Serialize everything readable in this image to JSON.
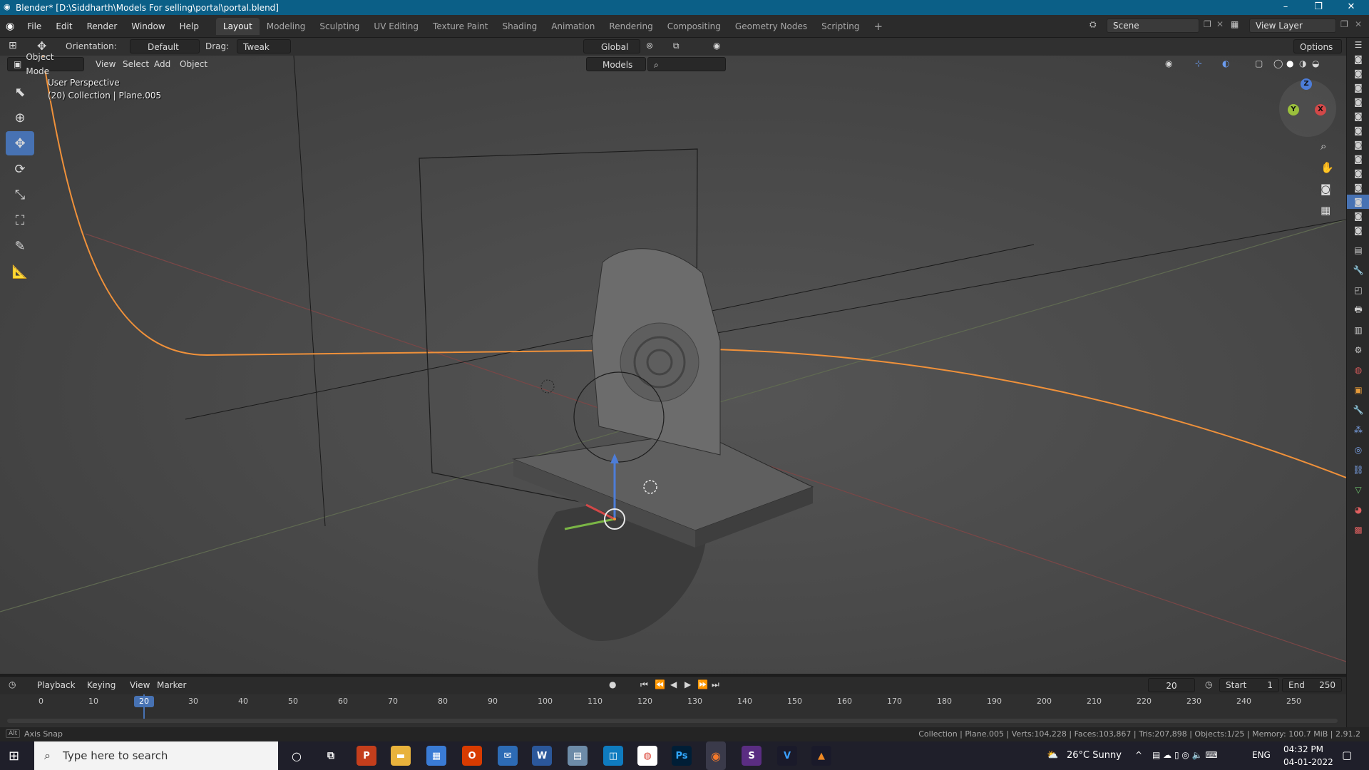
{
  "window": {
    "title": "Blender* [D:\\Siddharth\\Models For selling\\portal\\portal.blend]",
    "minimize": "–",
    "maximize": "❐",
    "close": "✕"
  },
  "menu": {
    "items": [
      "File",
      "Edit",
      "Render",
      "Window",
      "Help"
    ]
  },
  "workspaces": {
    "tabs": [
      "Layout",
      "Modeling",
      "Sculpting",
      "UV Editing",
      "Texture Paint",
      "Shading",
      "Animation",
      "Rendering",
      "Compositing",
      "Geometry Nodes",
      "Scripting"
    ],
    "active": "Layout",
    "add": "+"
  },
  "scene": {
    "label": "Scene",
    "view_layer": "View Layer"
  },
  "tool_header": {
    "orientation_label": "Orientation:",
    "orientation_value": "Default",
    "drag_label": "Drag:",
    "drag_value": "Tweak",
    "transform_orientation": "Global",
    "options": "Options"
  },
  "viewport_header": {
    "mode": "Object Mode",
    "menus": [
      "View",
      "Select",
      "Add",
      "Object"
    ],
    "collection": "Models"
  },
  "viewport": {
    "perspective": "User Perspective",
    "context": "(20) Collection | Plane.005",
    "axes": {
      "x": "X",
      "y": "Y",
      "z": "Z"
    }
  },
  "timeline": {
    "menus": [
      "Playback",
      "Keying",
      "View",
      "Marker"
    ],
    "current_frame": "20",
    "start_label": "Start",
    "start_value": "1",
    "end_label": "End",
    "end_value": "250",
    "ticks": [
      "0",
      "10",
      "20",
      "30",
      "40",
      "50",
      "60",
      "70",
      "80",
      "90",
      "100",
      "110",
      "120",
      "130",
      "140",
      "150",
      "160",
      "170",
      "180",
      "190",
      "200",
      "210",
      "220",
      "230",
      "240",
      "250"
    ]
  },
  "statusbar": {
    "left_key": "Alt",
    "left_text": "Axis Snap",
    "right_text": "Collection | Plane.005 | Verts:104,228 | Faces:103,867 | Tris:207,898 | Objects:1/25 | Memory: 100.7 MiB | 2.91.2"
  },
  "taskbar": {
    "search_placeholder": "Type here to search",
    "weather": "26°C  Sunny",
    "lang": "ENG",
    "time": "04:32 PM",
    "date": "04-01-2022"
  }
}
